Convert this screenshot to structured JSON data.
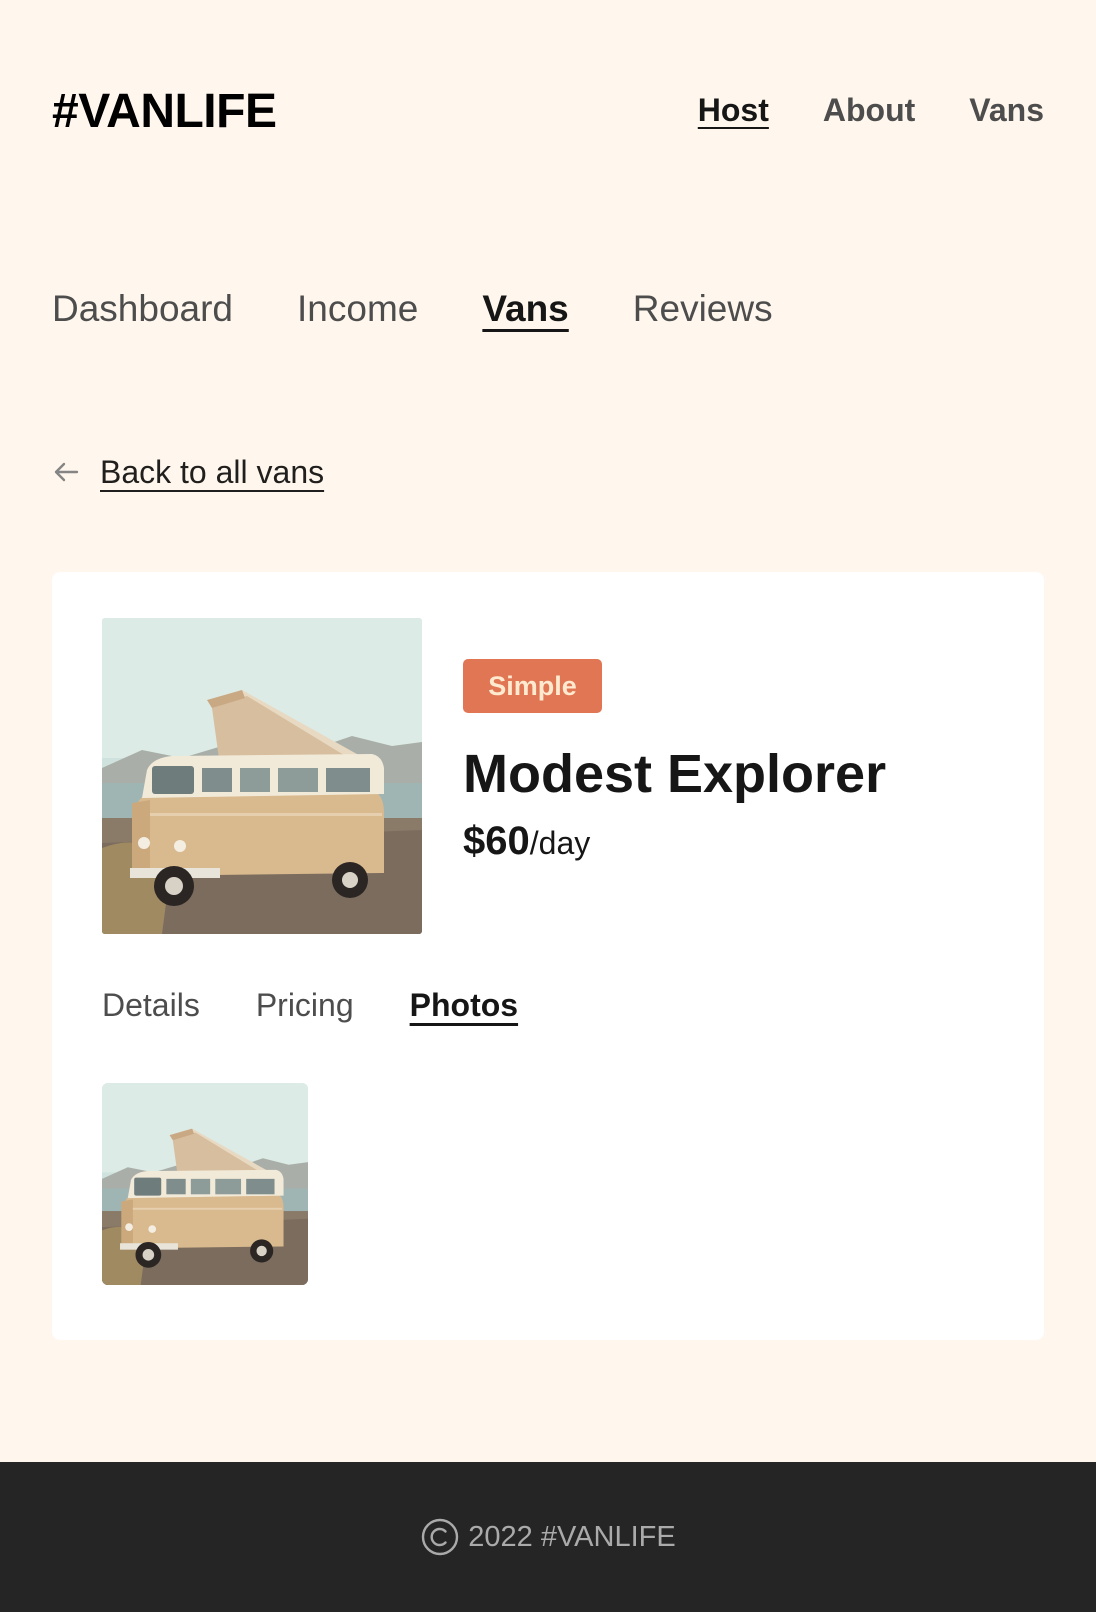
{
  "header": {
    "logo": "#VANLIFE",
    "nav": [
      {
        "label": "Host",
        "active": true
      },
      {
        "label": "About",
        "active": false
      },
      {
        "label": "Vans",
        "active": false
      }
    ]
  },
  "host_nav": [
    {
      "label": "Dashboard",
      "active": false
    },
    {
      "label": "Income",
      "active": false
    },
    {
      "label": "Vans",
      "active": true
    },
    {
      "label": "Reviews",
      "active": false
    }
  ],
  "back_link": {
    "icon": "arrow-left-icon",
    "label": "Back to all vans"
  },
  "van": {
    "type": "Simple",
    "name": "Modest Explorer",
    "price": "$60",
    "price_unit": "/day",
    "badge_color": "#E17654",
    "image": "van-photo-image"
  },
  "detail_nav": [
    {
      "label": "Details",
      "active": false
    },
    {
      "label": "Pricing",
      "active": false
    },
    {
      "label": "Photos",
      "active": true
    }
  ],
  "footer": {
    "icon": "copyright-icon",
    "text": "2022 #VANLIFE"
  },
  "colors": {
    "page_bg": "#FFF7ED",
    "card_bg": "#FFFFFF",
    "footer_bg": "#252525",
    "accent": "#E17654"
  }
}
